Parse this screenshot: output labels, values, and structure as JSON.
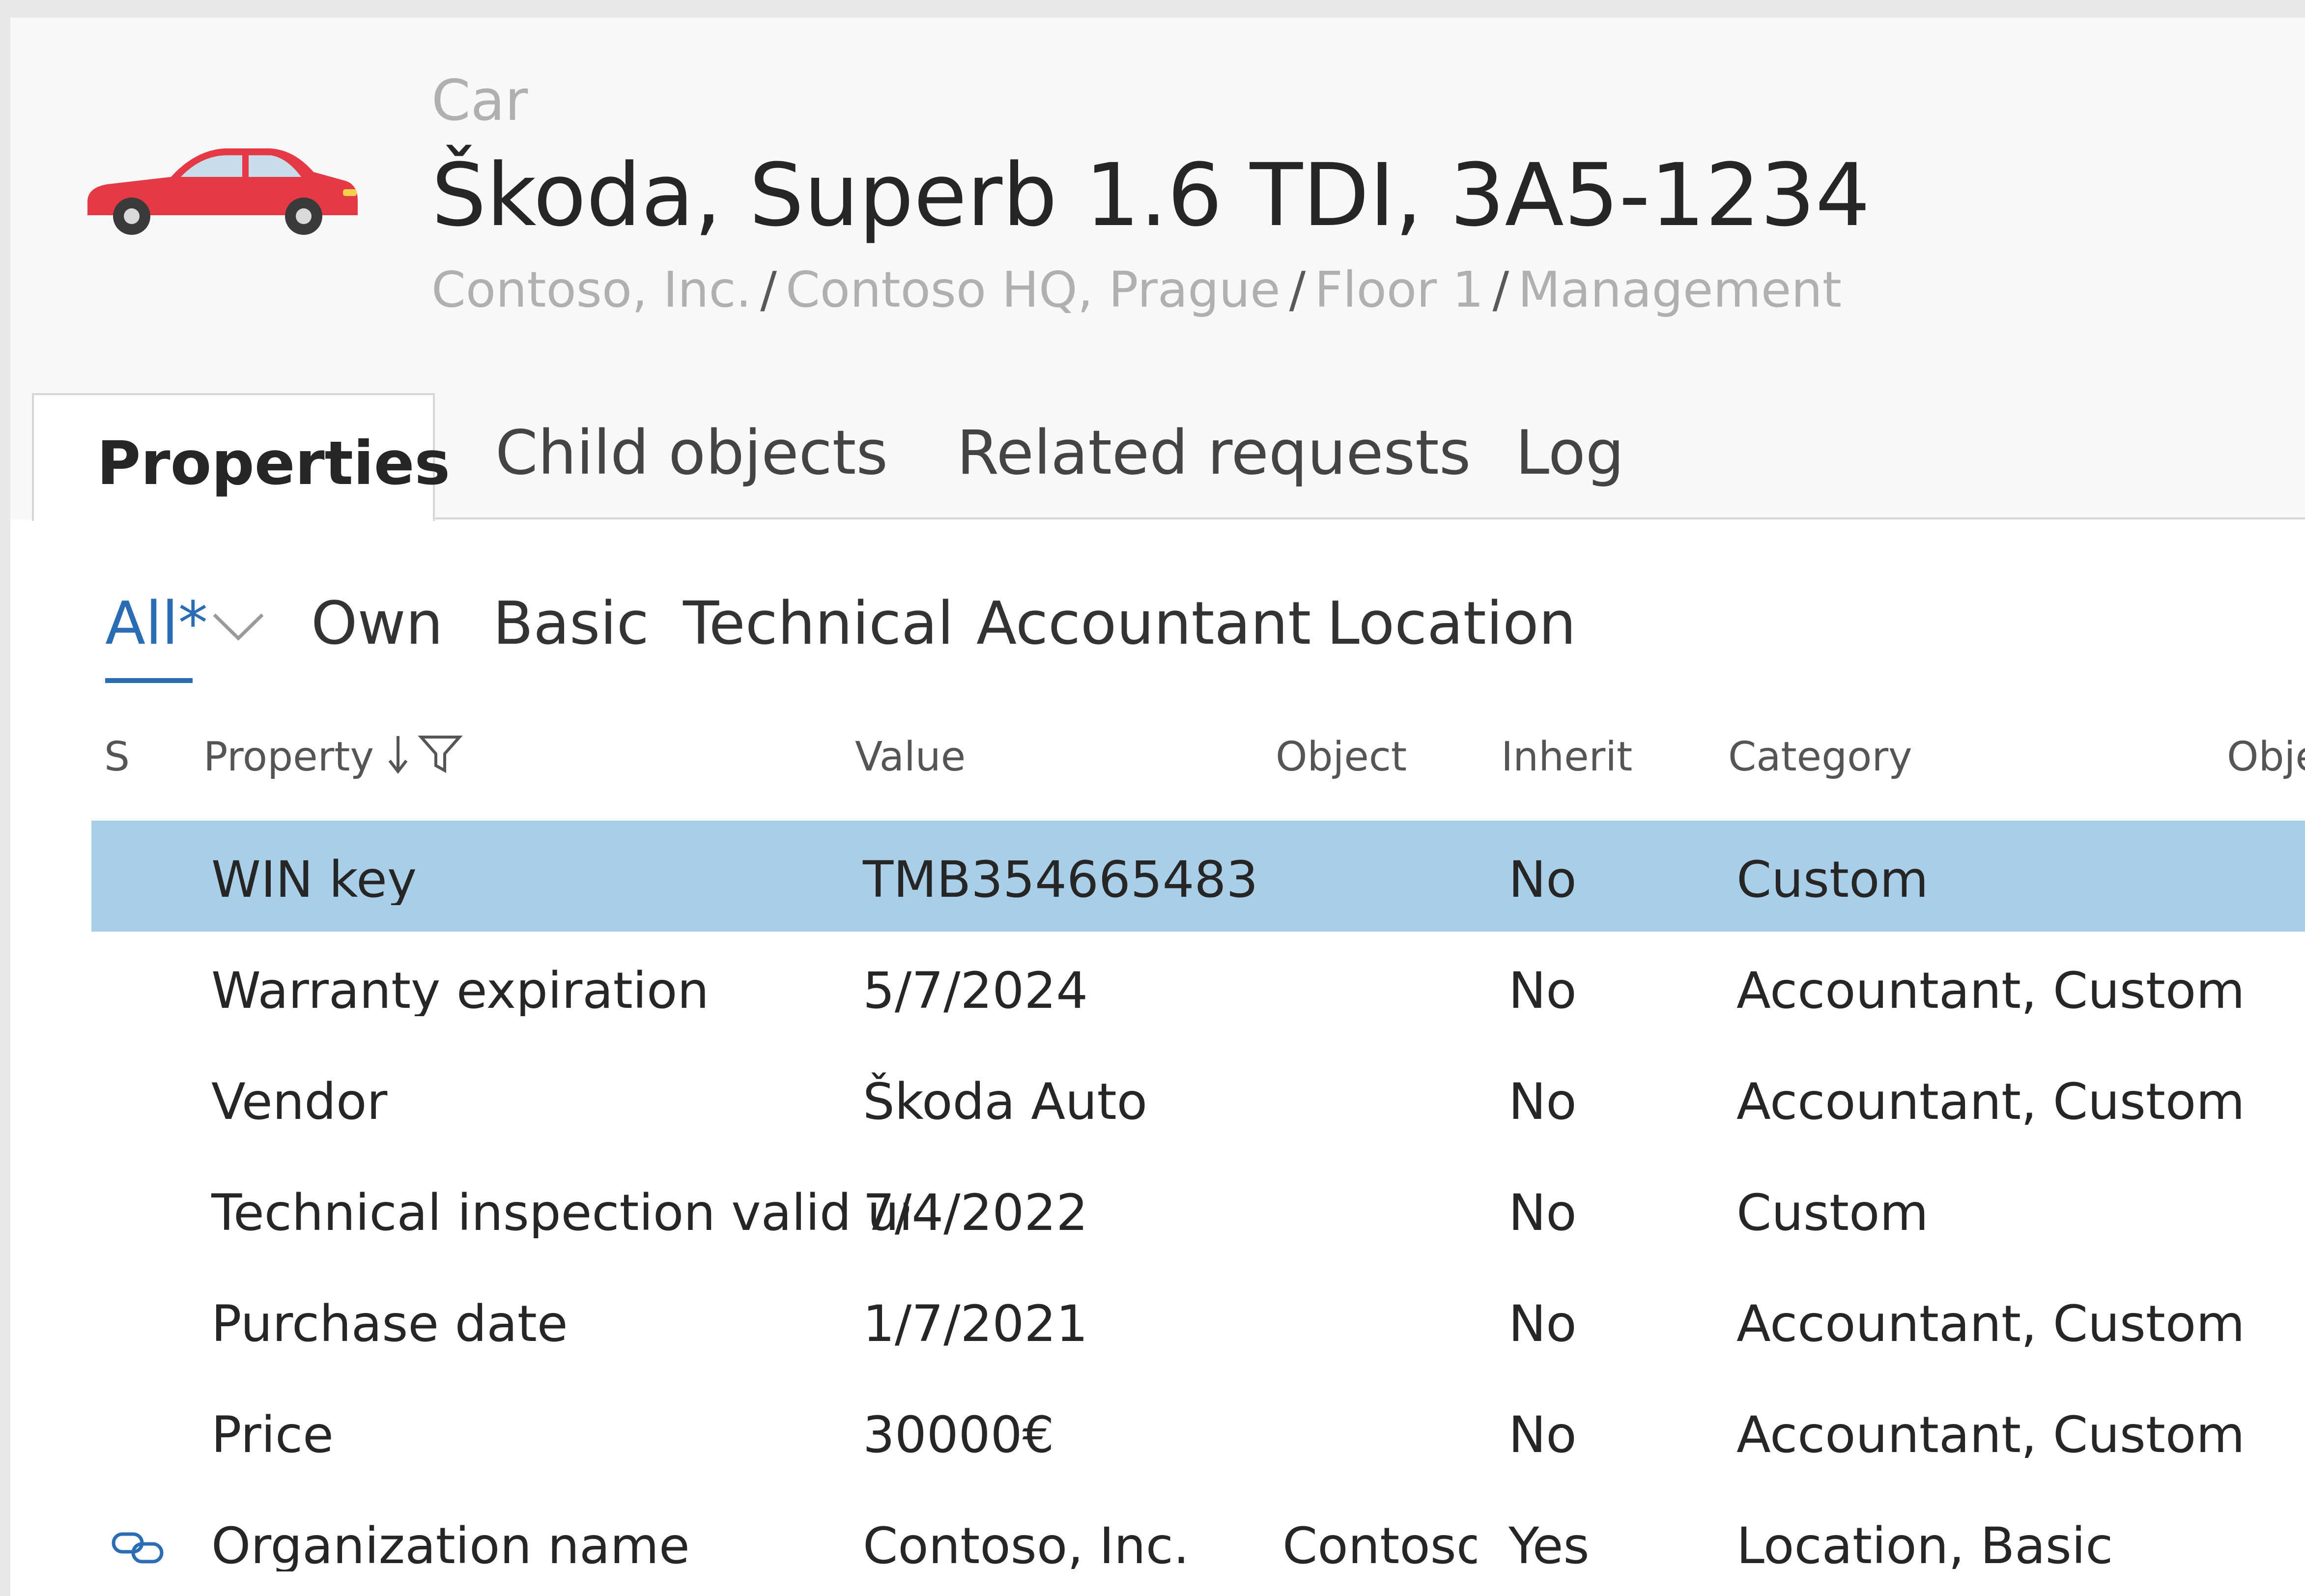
{
  "header": {
    "object_type": "Car",
    "title": "Škoda, Superb 1.6 TDI, 3A5-1234",
    "breadcrumb": [
      "Contoso, Inc.",
      "Contoso HQ, Prague",
      "Floor 1",
      "Management"
    ],
    "icon": "car-icon",
    "icon_color": "#e63946"
  },
  "tabs": [
    {
      "label": "Properties",
      "active": true
    },
    {
      "label": "Child objects"
    },
    {
      "label": "Related requests"
    },
    {
      "label": "Log"
    }
  ],
  "filters": [
    {
      "label": "All*",
      "active": true
    },
    {
      "label": "Own"
    },
    {
      "label": "Basic"
    },
    {
      "label": "Technical"
    },
    {
      "label": "Accountant"
    },
    {
      "label": "Location"
    }
  ],
  "columns": [
    "S",
    "Property",
    "Value",
    "Object",
    "Inherit",
    "Category",
    "Obje"
  ],
  "rows": [
    {
      "property": "WIN key",
      "value": "TMB354665483",
      "object": "",
      "inherit": "No",
      "category": "Custom",
      "selected": true
    },
    {
      "property": "Warranty expiration",
      "value": "5/7/2024",
      "object": "",
      "inherit": "No",
      "category": "Accountant, Custom"
    },
    {
      "property": "Vendor",
      "value": "Škoda Auto",
      "object": "",
      "inherit": "No",
      "category": "Accountant, Custom"
    },
    {
      "property": "Technical inspection valid ur",
      "value": "7/4/2022",
      "object": "",
      "inherit": "No",
      "category": "Custom"
    },
    {
      "property": "Purchase date",
      "value": "1/7/2021",
      "object": "",
      "inherit": "No",
      "category": "Accountant, Custom"
    },
    {
      "property": "Price",
      "value": "30000€",
      "object": "",
      "inherit": "No",
      "category": "Accountant, Custom"
    },
    {
      "property": "Organization name",
      "value": "Contoso, Inc.",
      "object": "Contoso,",
      "inherit": "Yes",
      "category": "Location, Basic",
      "status_icon": "link-icon"
    }
  ],
  "colors": {
    "accent": "#2a6db5",
    "selected_row": "#a9cfe8"
  }
}
